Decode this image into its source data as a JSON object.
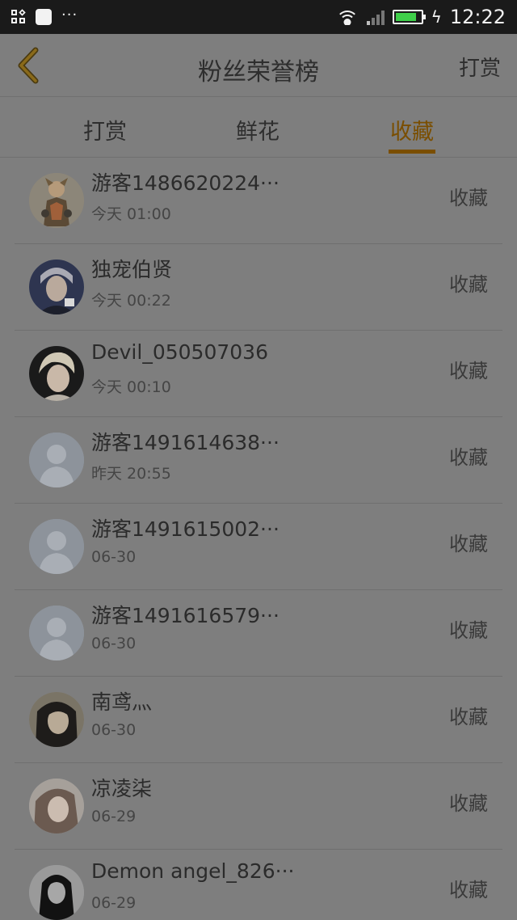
{
  "statusbar": {
    "time": "12:22",
    "more": "···",
    "battery_fill": 0.85
  },
  "header": {
    "title": "粉丝荣誉榜",
    "right_link": "打赏"
  },
  "tabs": [
    {
      "label": "打赏",
      "active": false
    },
    {
      "label": "鲜花",
      "active": false
    },
    {
      "label": "收藏",
      "active": true
    }
  ],
  "accent_color": "#7a4e00",
  "fans": [
    {
      "name": "游客1486620224···",
      "time": "今天  01:00",
      "action": "收藏",
      "avatar": "anime-character"
    },
    {
      "name": "独宠伯贤",
      "time": "今天  00:22",
      "action": "收藏",
      "avatar": "photo-person"
    },
    {
      "name": "Devil_050507036",
      "time": "今天  00:10",
      "action": "收藏",
      "avatar": "photo-person"
    },
    {
      "name": "游客1491614638···",
      "time": "昨天  20:55",
      "action": "收藏",
      "avatar": "default"
    },
    {
      "name": "游客1491615002···",
      "time": "06-30",
      "action": "收藏",
      "avatar": "default"
    },
    {
      "name": "游客1491616579···",
      "time": "06-30",
      "action": "收藏",
      "avatar": "default"
    },
    {
      "name": "南鸢灬",
      "time": "06-30",
      "action": "收藏",
      "avatar": "photo-person"
    },
    {
      "name": "凉凌柒",
      "time": "06-29",
      "action": "收藏",
      "avatar": "photo-person"
    },
    {
      "name": "Demon  angel_826···",
      "time": "06-29",
      "action": "收藏",
      "avatar": "drawing-girl"
    }
  ]
}
